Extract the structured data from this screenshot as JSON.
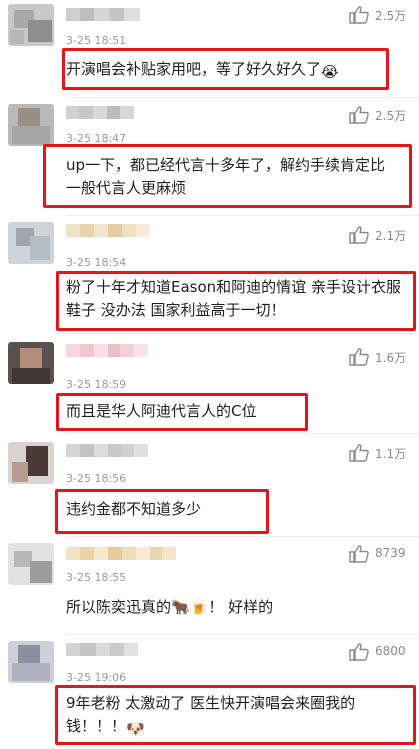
{
  "comments": [
    {
      "time": "3-25 18:51",
      "likes": "2.5万",
      "text": "开演唱会补贴家用吧，等了好久好久了",
      "emoji": "😭",
      "emoji_name": "crying-face-icon"
    },
    {
      "time": "3-25 18:47",
      "likes": "2.5万",
      "text": "up一下，都已经代言十多年了，解约手续肯定比一般代言人更麻烦",
      "emoji": "",
      "emoji_name": ""
    },
    {
      "time": "3-25 18:54",
      "likes": "2.1万",
      "text": "粉了十年才知道Eason和阿迪的情谊 亲手设计衣服鞋子 没办法 国家利益高于一切！",
      "emoji": "",
      "emoji_name": ""
    },
    {
      "time": "3-25 18:59",
      "likes": "1.6万",
      "text": "而且是华人阿迪代言人的C位",
      "emoji": "",
      "emoji_name": ""
    },
    {
      "time": "3-25 18:56",
      "likes": "1.1万",
      "text": "违约金都不知道多少",
      "emoji": "",
      "emoji_name": ""
    },
    {
      "time": "3-25 18:55",
      "likes": "8739",
      "text": "所以陈奕迅真的🐂🍺！ 好样的",
      "emoji": "",
      "emoji_name": ""
    },
    {
      "time": "3-25 19:06",
      "likes": "6800",
      "text": "9年老粉 太激动了 医生快开演唱会来圈我的钱！！！",
      "emoji": "🐶",
      "emoji_name": "doge-icon"
    }
  ],
  "colors": {
    "highlight_box": "#e5151a",
    "timestamp": "#9a9a9a",
    "like_count": "#8a8a8a",
    "text": "#1f1f1f"
  },
  "icons": {
    "like": "thumbs-up-icon"
  }
}
